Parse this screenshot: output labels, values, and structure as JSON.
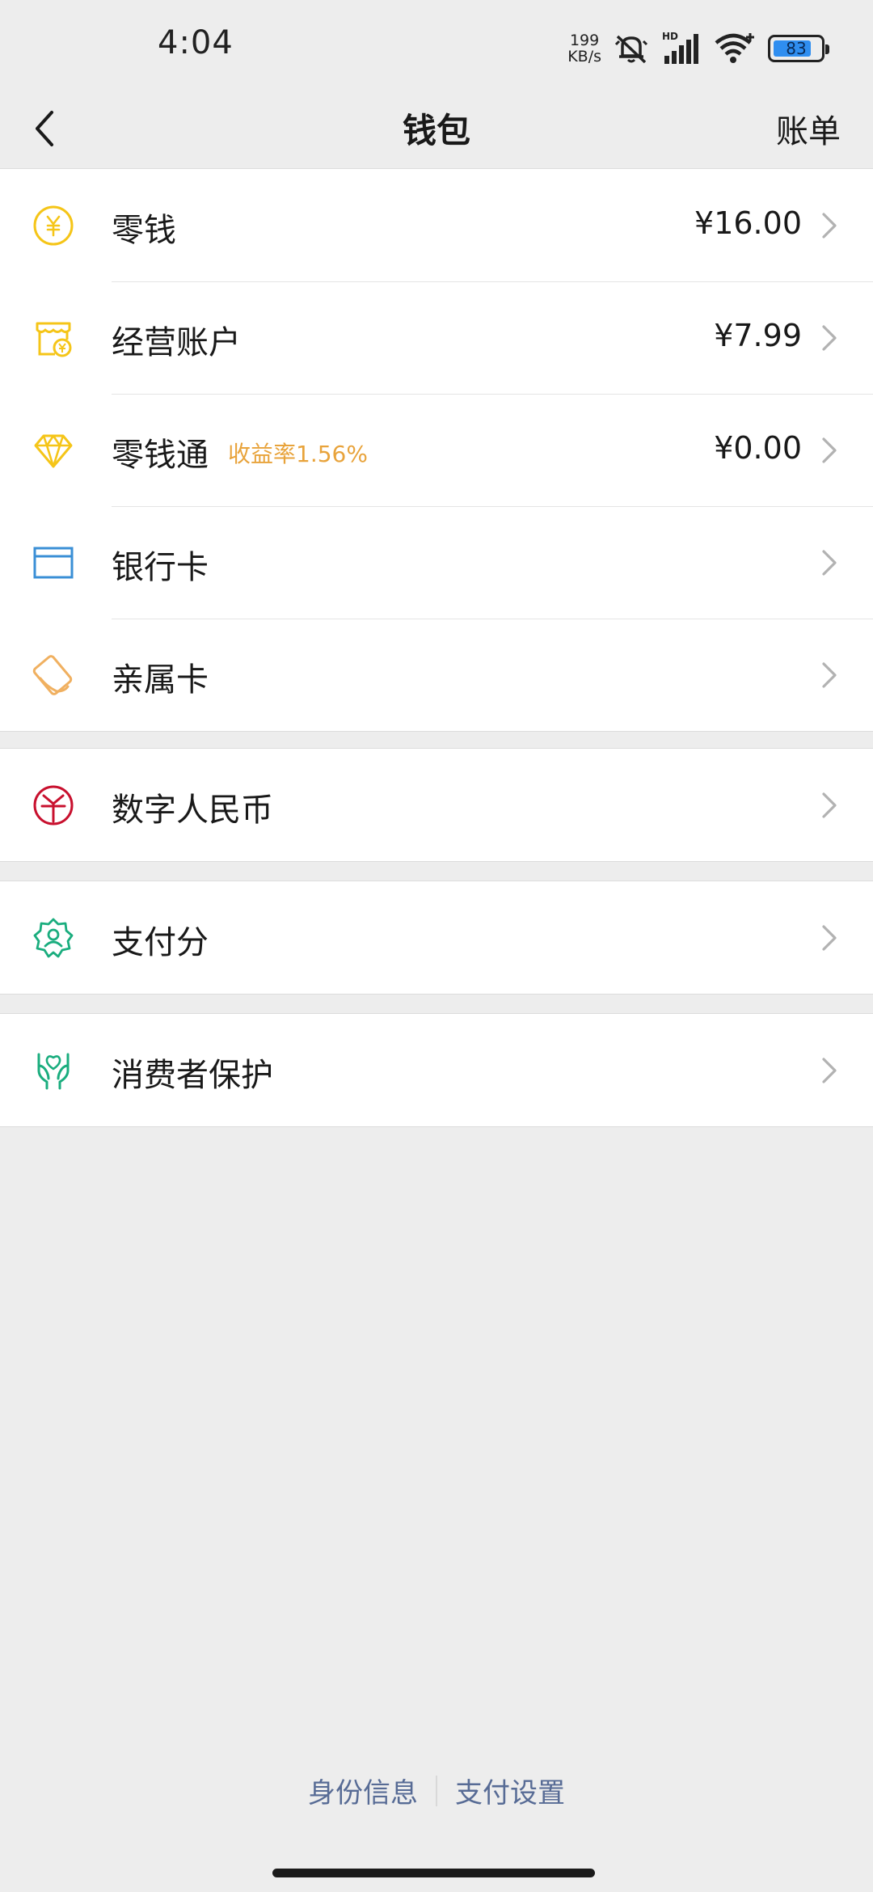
{
  "status_bar": {
    "time": "4:04",
    "net_speed_value": "199",
    "net_speed_unit": "KB/s",
    "battery_level": "83",
    "battery_fraction": 0.83
  },
  "nav": {
    "title": "钱包",
    "right_label": "账单"
  },
  "groups": {
    "main": [
      {
        "icon": "yuan-coin-icon",
        "label": "零钱",
        "value": "¥16.00"
      },
      {
        "icon": "shop-account-icon",
        "label": "经营账户",
        "value": "¥7.99"
      },
      {
        "icon": "diamond-icon",
        "label": "零钱通",
        "tag": "收益率1.56%",
        "value": "¥0.00"
      },
      {
        "icon": "bank-card-icon",
        "label": "银行卡"
      },
      {
        "icon": "family-card-icon",
        "label": "亲属卡"
      }
    ],
    "digital_rmb": {
      "icon": "digital-rmb-icon",
      "label": "数字人民币"
    },
    "pay_score": {
      "icon": "pay-score-icon",
      "label": "支付分"
    },
    "consumer_protection": {
      "icon": "hands-protect-icon",
      "label": "消费者保护"
    }
  },
  "footer": {
    "identity": "身份信息",
    "pay_settings": "支付设置"
  },
  "colors": {
    "background": "#ededed",
    "card": "#ffffff",
    "yellow_icon": "#f5c518",
    "orange_tag": "#e8a33b",
    "blue_icon": "#3a8fd6",
    "red_icon": "#c8102e",
    "green_icon": "#1aad7e",
    "link": "#576b95"
  }
}
